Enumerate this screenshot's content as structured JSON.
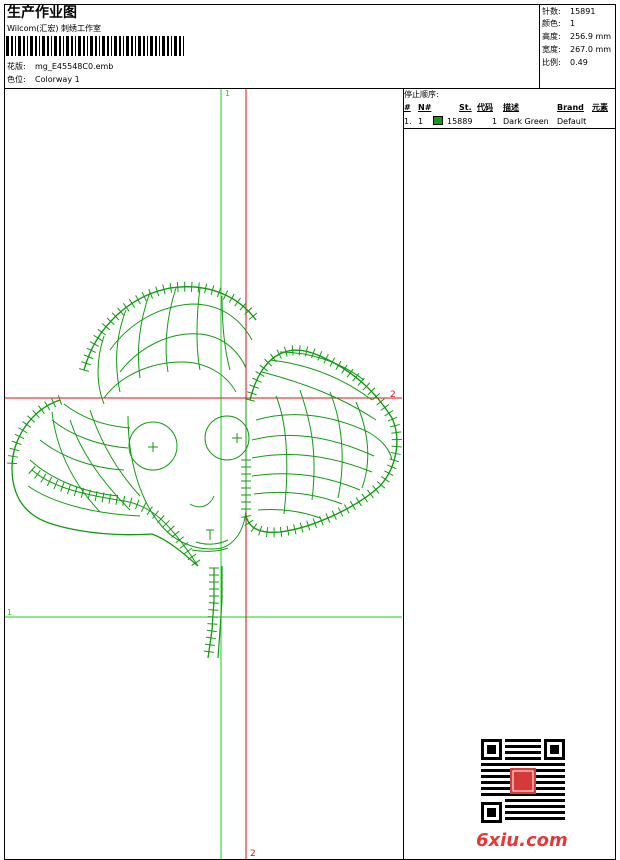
{
  "header": {
    "title": "生产作业图",
    "company": "Wilcom(汇宏) 刺绣工作室",
    "design_label": "花版:",
    "design_value": "mg_E45548C0.emb",
    "colorway_label": "色位:",
    "colorway_value": "Colorway 1"
  },
  "stats": {
    "stitches_label": "针数:",
    "stitches_value": "15891",
    "colors_label": "颜色:",
    "colors_value": "1",
    "height_label": "高度:",
    "height_value": "256.9 mm",
    "width_label": "宽度:",
    "width_value": "267.0 mm",
    "scale_label": "比例:",
    "scale_value": "0.49"
  },
  "sequence": {
    "title": "停止顺序:",
    "columns": [
      "#",
      "N#",
      "St.",
      "代码",
      "描述",
      "Brand",
      "元素"
    ],
    "rows": [
      {
        "num": "1.",
        "needle": "1",
        "stitches": "15889",
        "code": "1",
        "description": "Dark Green",
        "brand": "Default",
        "color": "#129a12"
      }
    ]
  },
  "guides": {
    "v_green_label": "1",
    "h_green_label": "1",
    "v_red_label": "2",
    "h_red_label": "2"
  },
  "watermark": {
    "site": "6xiu.com"
  },
  "colors": {
    "stitch": "#129a12",
    "guide_green": "#22cc22",
    "guide_red": "#dd1111"
  }
}
